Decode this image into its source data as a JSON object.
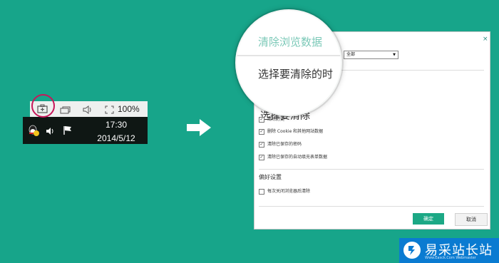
{
  "taskbar": {
    "zoom": "100%",
    "time": "17:30",
    "date": "2014/5/12"
  },
  "dialog": {
    "title": "清除浏览数据",
    "range_label": "选择要清除的时",
    "range_value": "全部",
    "section_clear": "选择要清除",
    "items": [
      "清除历史",
      "删除 Cookie 和其他网站数据",
      "清除已保存的密码",
      "清除已保存的自动填充表单数据"
    ],
    "section_prefs": "偏好设置",
    "pref_item": "每次关闭浏览器后清除",
    "ok": "确定",
    "cancel": "取消",
    "close": "×"
  },
  "logo": {
    "name": "易采站长站",
    "url": "Www.Easck.Com Webmaster"
  },
  "colors": {
    "background": "#17a58a",
    "accent": "#1ca885",
    "highlight_ring": "#c8165a",
    "logo_blue": "#0a7bd1"
  },
  "icons": [
    "toolbox-icon",
    "window-icon",
    "volume-icon",
    "fullscreen-icon",
    "qq-icon",
    "speaker-icon",
    "flag-icon",
    "arrow-right-icon",
    "close-icon"
  ]
}
